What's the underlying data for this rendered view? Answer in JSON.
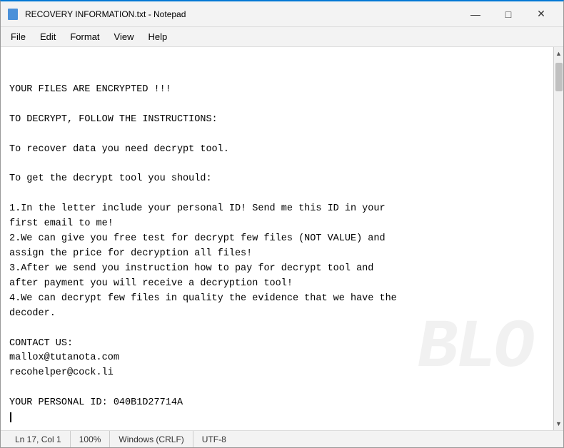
{
  "titleBar": {
    "title": "RECOVERY INFORMATION.txt - Notepad",
    "iconAlt": "notepad-icon"
  },
  "windowControls": {
    "minimize": "—",
    "maximize": "□",
    "close": "✕"
  },
  "menuBar": {
    "items": [
      "File",
      "Edit",
      "Format",
      "View",
      "Help"
    ]
  },
  "content": {
    "lines": "YOUR FILES ARE ENCRYPTED !!!\n\nTO DECRYPT, FOLLOW THE INSTRUCTIONS:\n\nTo recover data you need decrypt tool.\n\nTo get the decrypt tool you should:\n\n1.In the letter include your personal ID! Send me this ID in your\nfirst email to me!\n2.We can give you free test for decrypt few files (NOT VALUE) and\nassign the price for decryption all files!\n3.After we send you instruction how to pay for decrypt tool and\nafter payment you will receive a decryption tool!\n4.We can decrypt few files in quality the evidence that we have the\ndecoder.\n\nCONTACT US:\nmallox@tutanota.com\nrecohelper@cock.li\n\nYOUR PERSONAL ID: 040B1D27714A"
  },
  "statusBar": {
    "position": "Ln 17, Col 1",
    "zoom": "100%",
    "lineEnding": "Windows (CRLF)",
    "encoding": "UTF-8"
  },
  "watermark": {
    "text": "BLO"
  }
}
